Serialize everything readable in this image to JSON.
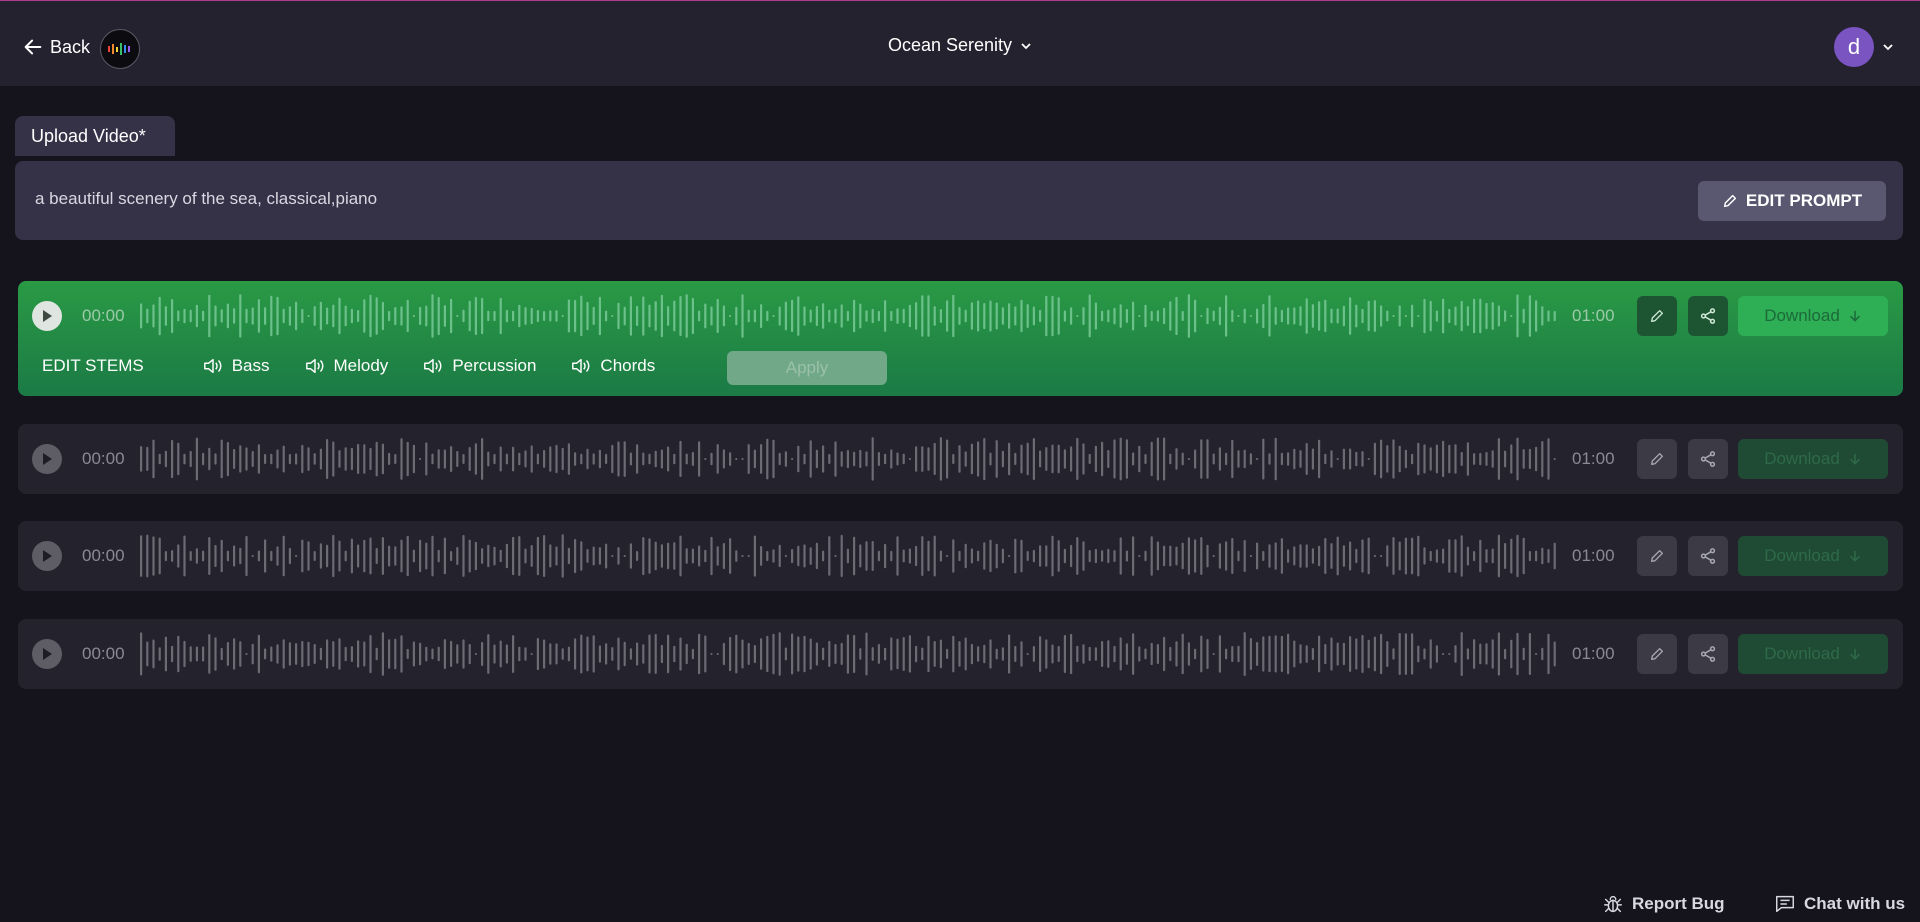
{
  "header": {
    "back_label": "Back",
    "project_title": "Ocean Serenity",
    "avatar_letter": "d"
  },
  "tabs": [
    {
      "label": "Upload Video*"
    }
  ],
  "prompt": {
    "text": "a beautiful scenery of the sea, classical,piano",
    "edit_label": "EDIT PROMPT"
  },
  "tracks": [
    {
      "start": "00:00",
      "end": "01:00",
      "download_label": "Download",
      "active": true,
      "seed": 7
    },
    {
      "start": "00:00",
      "end": "01:00",
      "download_label": "Download",
      "active": false,
      "seed": 13
    },
    {
      "start": "00:00",
      "end": "01:00",
      "download_label": "Download",
      "active": false,
      "seed": 29
    },
    {
      "start": "00:00",
      "end": "01:00",
      "download_label": "Download",
      "active": false,
      "seed": 41
    }
  ],
  "stems": {
    "title": "EDIT STEMS",
    "items": [
      {
        "label": "Bass"
      },
      {
        "label": "Melody"
      },
      {
        "label": "Percussion"
      },
      {
        "label": "Chords"
      }
    ],
    "apply_label": "Apply"
  },
  "footer": {
    "report_bug": "Report Bug",
    "chat": "Chat with us"
  },
  "colors": {
    "accent_green": "#2a9a45",
    "background": "#15141d",
    "avatar": "#7a55c2"
  },
  "icons": [
    "back-arrow-icon",
    "logo-icon",
    "chevron-down-icon",
    "pencil-icon",
    "share-icon",
    "arrow-down-icon",
    "speaker-icon",
    "bug-icon",
    "chat-icon",
    "play-icon"
  ]
}
